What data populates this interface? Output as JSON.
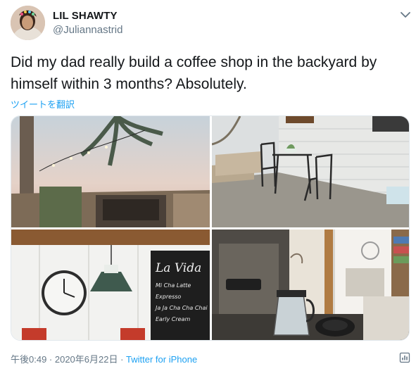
{
  "user": {
    "name": "LIL SHAWTY",
    "handle": "@Juliannastrid"
  },
  "tweet": {
    "text": "Did my dad really build a coffee shop in the backyard by himself within 3 months? Absolutely.",
    "translate_label": "ツイートを翻訳"
  },
  "chalkboard": {
    "title": "La Vida",
    "line1": "Mi Cha Latte",
    "line2": "Expresso",
    "line3": "Ja Ja Cha Cha Chai",
    "line4": "Early Cream"
  },
  "meta": {
    "timestamp": "午後0:49 · 2020年6月22日 · ",
    "source": "Twitter for iPhone"
  },
  "icons": {
    "menu": "chevron-down-icon",
    "stats": "analytics-icon"
  }
}
